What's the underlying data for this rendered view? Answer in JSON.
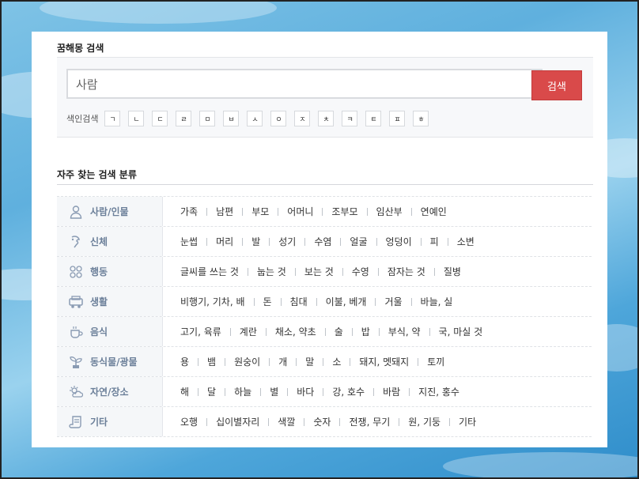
{
  "search": {
    "title": "꿈해몽 검색",
    "value": "사람",
    "button_label": "검색",
    "index_label": "색인검색",
    "index_keys": [
      "ㄱ",
      "ㄴ",
      "ㄷ",
      "ㄹ",
      "ㅁ",
      "ㅂ",
      "ㅅ",
      "ㅇ",
      "ㅈ",
      "ㅊ",
      "ㅋ",
      "ㅌ",
      "ㅍ",
      "ㅎ"
    ]
  },
  "categories_section": {
    "title": "자주 찾는 검색 분류",
    "rows": [
      {
        "name": "사람/인물",
        "icon": "person-icon",
        "items": [
          "가족",
          "남편",
          "부모",
          "어머니",
          "조부모",
          "임산부",
          "연예인"
        ]
      },
      {
        "name": "신체",
        "icon": "body-icon",
        "items": [
          "눈썹",
          "머리",
          "발",
          "성기",
          "수염",
          "얼굴",
          "엉덩이",
          "피",
          "소변"
        ]
      },
      {
        "name": "행동",
        "icon": "action-icon",
        "items": [
          "글씨를 쓰는 것",
          "눕는 것",
          "보는 것",
          "수영",
          "잠자는 것",
          "질병"
        ]
      },
      {
        "name": "생활",
        "icon": "car-icon",
        "items": [
          "비행기, 기차, 배",
          "돈",
          "침대",
          "이불, 베개",
          "거울",
          "바늘, 실"
        ]
      },
      {
        "name": "음식",
        "icon": "cup-icon",
        "items": [
          "고기, 육류",
          "계란",
          "채소, 약초",
          "술",
          "밥",
          "부식, 약",
          "국, 마실 것"
        ]
      },
      {
        "name": "동식물/광물",
        "icon": "plant-icon",
        "items": [
          "용",
          "뱀",
          "원숭이",
          "개",
          "말",
          "소",
          "돼지, 멧돼지",
          "토끼"
        ]
      },
      {
        "name": "자연/장소",
        "icon": "weather-icon",
        "items": [
          "해",
          "달",
          "하늘",
          "별",
          "바다",
          "강, 호수",
          "바람",
          "지진, 홍수"
        ]
      },
      {
        "name": "기타",
        "icon": "scroll-icon",
        "items": [
          "오행",
          "십이별자리",
          "색깔",
          "숫자",
          "전쟁, 무기",
          "원, 기둥",
          "기타"
        ]
      }
    ]
  },
  "colors": {
    "accent": "#d94a4a",
    "category_text": "#6b7f99"
  }
}
